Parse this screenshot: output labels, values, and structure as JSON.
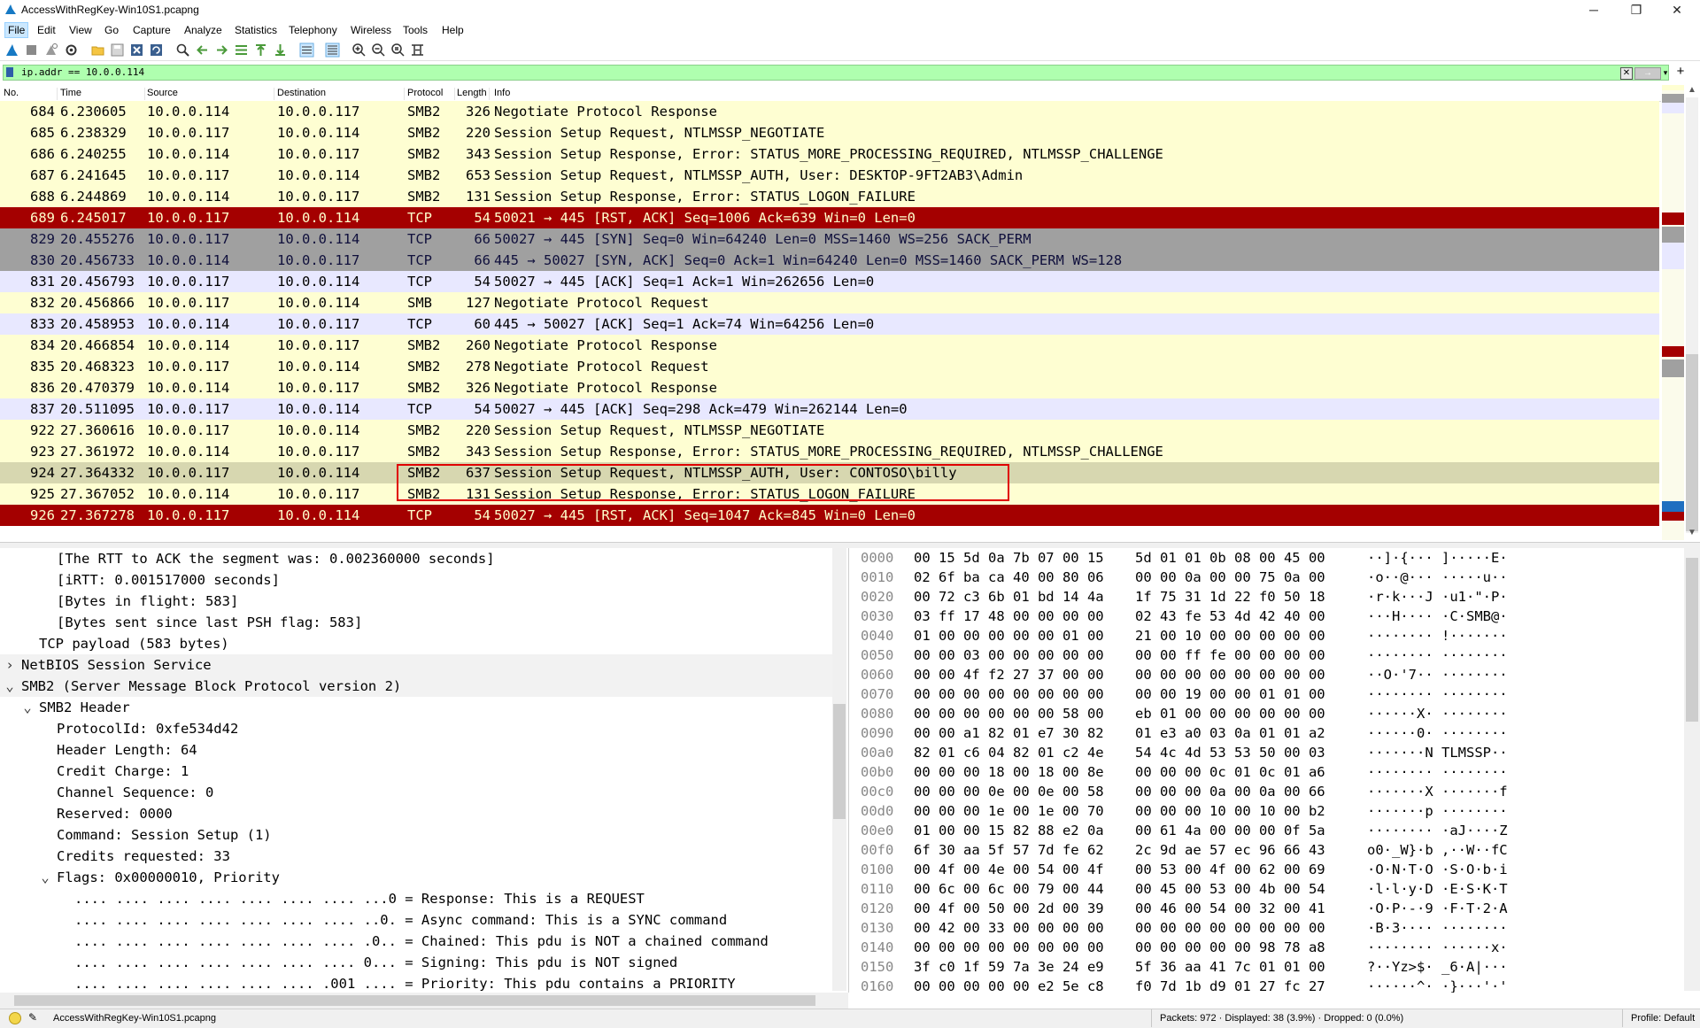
{
  "window": {
    "title": "AccessWithRegKey-Win10S1.pcapng",
    "minimize": "─",
    "restore": "❐",
    "close": "✕"
  },
  "menu": [
    "File",
    "Edit",
    "View",
    "Go",
    "Capture",
    "Analyze",
    "Statistics",
    "Telephony",
    "Wireless",
    "Tools",
    "Help"
  ],
  "filter": {
    "value": "ip.addr == 10.0.0.114",
    "apply": "→",
    "plus": "+"
  },
  "packet_list": {
    "columns": [
      "No.",
      "Time",
      "Source",
      "Destination",
      "Protocol",
      "Length",
      "Info"
    ],
    "rows": [
      {
        "no": "684",
        "time": "6.230605",
        "src": "10.0.0.114",
        "dst": "10.0.0.117",
        "proto": "SMB2",
        "len": "326",
        "info": "Negotiate Protocol Response",
        "style": "smb"
      },
      {
        "no": "685",
        "time": "6.238329",
        "src": "10.0.0.117",
        "dst": "10.0.0.114",
        "proto": "SMB2",
        "len": "220",
        "info": "Session Setup Request, NTLMSSP_NEGOTIATE",
        "style": "smb"
      },
      {
        "no": "686",
        "time": "6.240255",
        "src": "10.0.0.114",
        "dst": "10.0.0.117",
        "proto": "SMB2",
        "len": "343",
        "info": "Session Setup Response, Error: STATUS_MORE_PROCESSING_REQUIRED, NTLMSSP_CHALLENGE",
        "style": "smb"
      },
      {
        "no": "687",
        "time": "6.241645",
        "src": "10.0.0.117",
        "dst": "10.0.0.114",
        "proto": "SMB2",
        "len": "653",
        "info": "Session Setup Request, NTLMSSP_AUTH, User: DESKTOP-9FT2AB3\\Admin",
        "style": "smb"
      },
      {
        "no": "688",
        "time": "6.244869",
        "src": "10.0.0.114",
        "dst": "10.0.0.117",
        "proto": "SMB2",
        "len": "131",
        "info": "Session Setup Response, Error: STATUS_LOGON_FAILURE",
        "style": "smb"
      },
      {
        "no": "689",
        "time": "6.245017",
        "src": "10.0.0.117",
        "dst": "10.0.0.114",
        "proto": "TCP",
        "len": "54",
        "info": "50021 → 445 [RST, ACK] Seq=1006 Ack=639 Win=0 Len=0",
        "style": "rst"
      },
      {
        "no": "829",
        "time": "20.455276",
        "src": "10.0.0.117",
        "dst": "10.0.0.114",
        "proto": "TCP",
        "len": "66",
        "info": "50027 → 445 [SYN] Seq=0 Win=64240 Len=0 MSS=1460 WS=256 SACK_PERM",
        "style": "gray"
      },
      {
        "no": "830",
        "time": "20.456733",
        "src": "10.0.0.114",
        "dst": "10.0.0.117",
        "proto": "TCP",
        "len": "66",
        "info": "445 → 50027 [SYN, ACK] Seq=0 Ack=1 Win=64240 Len=0 MSS=1460 SACK_PERM WS=128",
        "style": "gray"
      },
      {
        "no": "831",
        "time": "20.456793",
        "src": "10.0.0.117",
        "dst": "10.0.0.114",
        "proto": "TCP",
        "len": "54",
        "info": "50027 → 445 [ACK] Seq=1 Ack=1 Win=262656 Len=0",
        "style": "tcp"
      },
      {
        "no": "832",
        "time": "20.456866",
        "src": "10.0.0.117",
        "dst": "10.0.0.114",
        "proto": "SMB",
        "len": "127",
        "info": "Negotiate Protocol Request",
        "style": "smb"
      },
      {
        "no": "833",
        "time": "20.458953",
        "src": "10.0.0.114",
        "dst": "10.0.0.117",
        "proto": "TCP",
        "len": "60",
        "info": "445 → 50027 [ACK] Seq=1 Ack=74 Win=64256 Len=0",
        "style": "tcp"
      },
      {
        "no": "834",
        "time": "20.466854",
        "src": "10.0.0.114",
        "dst": "10.0.0.117",
        "proto": "SMB2",
        "len": "260",
        "info": "Negotiate Protocol Response",
        "style": "smb"
      },
      {
        "no": "835",
        "time": "20.468323",
        "src": "10.0.0.117",
        "dst": "10.0.0.114",
        "proto": "SMB2",
        "len": "278",
        "info": "Negotiate Protocol Request",
        "style": "smb"
      },
      {
        "no": "836",
        "time": "20.470379",
        "src": "10.0.0.114",
        "dst": "10.0.0.117",
        "proto": "SMB2",
        "len": "326",
        "info": "Negotiate Protocol Response",
        "style": "smb"
      },
      {
        "no": "837",
        "time": "20.511095",
        "src": "10.0.0.117",
        "dst": "10.0.0.114",
        "proto": "TCP",
        "len": "54",
        "info": "50027 → 445 [ACK] Seq=298 Ack=479 Win=262144 Len=0",
        "style": "tcp"
      },
      {
        "no": "922",
        "time": "27.360616",
        "src": "10.0.0.117",
        "dst": "10.0.0.114",
        "proto": "SMB2",
        "len": "220",
        "info": "Session Setup Request, NTLMSSP_NEGOTIATE",
        "style": "smb"
      },
      {
        "no": "923",
        "time": "27.361972",
        "src": "10.0.0.114",
        "dst": "10.0.0.117",
        "proto": "SMB2",
        "len": "343",
        "info": "Session Setup Response, Error: STATUS_MORE_PROCESSING_REQUIRED, NTLMSSP_CHALLENGE",
        "style": "smb"
      },
      {
        "no": "924",
        "time": "27.364332",
        "src": "10.0.0.117",
        "dst": "10.0.0.114",
        "proto": "SMB2",
        "len": "637",
        "info": "Session Setup Request, NTLMSSP_AUTH, User: CONTOSO\\billy",
        "style": "sel"
      },
      {
        "no": "925",
        "time": "27.367052",
        "src": "10.0.0.114",
        "dst": "10.0.0.117",
        "proto": "SMB2",
        "len": "131",
        "info": "Session Setup Response, Error: STATUS_LOGON_FAILURE",
        "style": "smb"
      },
      {
        "no": "926",
        "time": "27.367278",
        "src": "10.0.0.117",
        "dst": "10.0.0.114",
        "proto": "TCP",
        "len": "54",
        "info": "50027 → 445 [RST, ACK] Seq=1047 Ack=845 Win=0 Len=0",
        "style": "rst"
      }
    ]
  },
  "details": [
    {
      "indent": 3,
      "arrow": "",
      "text": "[The RTT to ACK the segment was: 0.002360000 seconds]"
    },
    {
      "indent": 3,
      "arrow": "",
      "text": "[iRTT: 0.001517000 seconds]"
    },
    {
      "indent": 3,
      "arrow": "",
      "text": "[Bytes in flight: 583]"
    },
    {
      "indent": 3,
      "arrow": "",
      "text": "[Bytes sent since last PSH flag: 583]"
    },
    {
      "indent": 2,
      "arrow": "",
      "text": "TCP payload (583 bytes)"
    },
    {
      "indent": 1,
      "arrow": "›",
      "text": "NetBIOS Session Service"
    },
    {
      "indent": 1,
      "arrow": "⌄",
      "text": "SMB2 (Server Message Block Protocol version 2)"
    },
    {
      "indent": 2,
      "arrow": "⌄",
      "text": "SMB2 Header"
    },
    {
      "indent": 3,
      "arrow": "",
      "text": "ProtocolId: 0xfe534d42"
    },
    {
      "indent": 3,
      "arrow": "",
      "text": "Header Length: 64"
    },
    {
      "indent": 3,
      "arrow": "",
      "text": "Credit Charge: 1"
    },
    {
      "indent": 3,
      "arrow": "",
      "text": "Channel Sequence: 0"
    },
    {
      "indent": 3,
      "arrow": "",
      "text": "Reserved: 0000"
    },
    {
      "indent": 3,
      "arrow": "",
      "text": "Command: Session Setup (1)"
    },
    {
      "indent": 3,
      "arrow": "",
      "text": "Credits requested: 33"
    },
    {
      "indent": 3,
      "arrow": "⌄",
      "text": "Flags: 0x00000010, Priority"
    },
    {
      "indent": 4,
      "arrow": "",
      "text": ".... .... .... .... .... .... .... ...0 = Response: This is a REQUEST"
    },
    {
      "indent": 4,
      "arrow": "",
      "text": ".... .... .... .... .... .... .... ..0. = Async command: This is a SYNC command"
    },
    {
      "indent": 4,
      "arrow": "",
      "text": ".... .... .... .... .... .... .... .0.. = Chained: This pdu is NOT a chained command"
    },
    {
      "indent": 4,
      "arrow": "",
      "text": ".... .... .... .... .... .... .... 0... = Signing: This pdu is NOT signed"
    },
    {
      "indent": 4,
      "arrow": "",
      "text": ".... .... .... .... .... .... .001 .... = Priority: This pdu contains a PRIORITY"
    }
  ],
  "bytes": [
    {
      "off": "0000",
      "h1": "00 15 5d 0a 7b 07 00 15",
      "h2": "5d 01 01 0b 08 00 45 00",
      "asc": "··]·{··· ]·····E·"
    },
    {
      "off": "0010",
      "h1": "02 6f ba ca 40 00 80 06",
      "h2": "00 00 0a 00 00 75 0a 00",
      "asc": "·o··@··· ·····u··"
    },
    {
      "off": "0020",
      "h1": "00 72 c3 6b 01 bd 14 4a",
      "h2": "1f 75 31 1d 22 f0 50 18",
      "asc": "·r·k···J ·u1·\"·P·"
    },
    {
      "off": "0030",
      "h1": "03 ff 17 48 00 00 00 00",
      "h2": "02 43 fe 53 4d 42 40 00",
      "asc": "···H···· ·C·SMB@·"
    },
    {
      "off": "0040",
      "h1": "01 00 00 00 00 00 01 00",
      "h2": "21 00 10 00 00 00 00 00",
      "asc": "········ !·······"
    },
    {
      "off": "0050",
      "h1": "00 00 03 00 00 00 00 00",
      "h2": "00 00 ff fe 00 00 00 00",
      "asc": "········ ········"
    },
    {
      "off": "0060",
      "h1": "00 00 4f f2 27 37 00 00",
      "h2": "00 00 00 00 00 00 00 00",
      "asc": "··O·'7·· ········"
    },
    {
      "off": "0070",
      "h1": "00 00 00 00 00 00 00 00",
      "h2": "00 00 19 00 00 01 01 00",
      "asc": "········ ········"
    },
    {
      "off": "0080",
      "h1": "00 00 00 00 00 00 58 00",
      "h2": "eb 01 00 00 00 00 00 00",
      "asc": "······X· ········"
    },
    {
      "off": "0090",
      "h1": "00 00 a1 82 01 e7 30 82",
      "h2": "01 e3 a0 03 0a 01 01 a2",
      "asc": "······0· ········"
    },
    {
      "off": "00a0",
      "h1": "82 01 c6 04 82 01 c2 4e",
      "h2": "54 4c 4d 53 53 50 00 03",
      "asc": "·······N TLMSSP··"
    },
    {
      "off": "00b0",
      "h1": "00 00 00 18 00 18 00 8e",
      "h2": "00 00 00 0c 01 0c 01 a6",
      "asc": "········ ········"
    },
    {
      "off": "00c0",
      "h1": "00 00 00 0e 00 0e 00 58",
      "h2": "00 00 00 0a 00 0a 00 66",
      "asc": "·······X ·······f"
    },
    {
      "off": "00d0",
      "h1": "00 00 00 1e 00 1e 00 70",
      "h2": "00 00 00 10 00 10 00 b2",
      "asc": "·······p ········"
    },
    {
      "off": "00e0",
      "h1": "01 00 00 15 82 88 e2 0a",
      "h2": "00 61 4a 00 00 00 0f 5a",
      "asc": "········ ·aJ····Z"
    },
    {
      "off": "00f0",
      "h1": "6f 30 aa 5f 57 7d fe 62",
      "h2": "2c 9d ae 57 ec 96 66 43",
      "asc": "o0·_W}·b ,··W··fC"
    },
    {
      "off": "0100",
      "h1": "00 4f 00 4e 00 54 00 4f",
      "h2": "00 53 00 4f 00 62 00 69",
      "asc": "·O·N·T·O ·S·O·b·i"
    },
    {
      "off": "0110",
      "h1": "00 6c 00 6c 00 79 00 44",
      "h2": "00 45 00 53 00 4b 00 54",
      "asc": "·l·l·y·D ·E·S·K·T"
    },
    {
      "off": "0120",
      "h1": "00 4f 00 50 00 2d 00 39",
      "h2": "00 46 00 54 00 32 00 41",
      "asc": "·O·P·-·9 ·F·T·2·A"
    },
    {
      "off": "0130",
      "h1": "00 42 00 33 00 00 00 00",
      "h2": "00 00 00 00 00 00 00 00",
      "asc": "·B·3···· ········"
    },
    {
      "off": "0140",
      "h1": "00 00 00 00 00 00 00 00",
      "h2": "00 00 00 00 00 98 78 a8",
      "asc": "········ ······x·"
    },
    {
      "off": "0150",
      "h1": "3f c0 1f 59 7a 3e 24 e9",
      "h2": "5f 36 aa 41 7c 01 01 00",
      "asc": "?··Yz>$· _6·A|···"
    },
    {
      "off": "0160",
      "h1": "00 00 00 00 00 e2 5e c8",
      "h2": "f0 7d 1b d9 01 27 fc 27",
      "asc": "······^· ·}···'·'"
    }
  ],
  "status": {
    "file": "AccessWithRegKey-Win10S1.pcapng",
    "stats": "Packets: 972 · Displayed: 38 (3.9%) · Dropped: 0 (0.0%)",
    "profile": "Profile: Default"
  },
  "colors": {
    "smb": "#fefed2",
    "tcp": "#e8e8ff",
    "rst": "#a40000",
    "gray": "#a0a0a0",
    "filter_ok": "#afffaf",
    "highlight": "#e00000"
  },
  "icons": {
    "app": "wireshark-fin-icon",
    "toolbar": [
      "shark-start-icon",
      "stop-icon",
      "restart-icon",
      "options-gear-icon",
      "open-folder-icon",
      "save-icon",
      "close-file-icon",
      "reload-icon",
      "find-icon",
      "back-icon",
      "forward-icon",
      "goto-icon",
      "first-icon",
      "last-icon",
      "autoscroll-icon",
      "colorize-icon",
      "zoom-in-icon",
      "zoom-out-icon",
      "normal-size-icon",
      "resize-columns-icon"
    ]
  }
}
